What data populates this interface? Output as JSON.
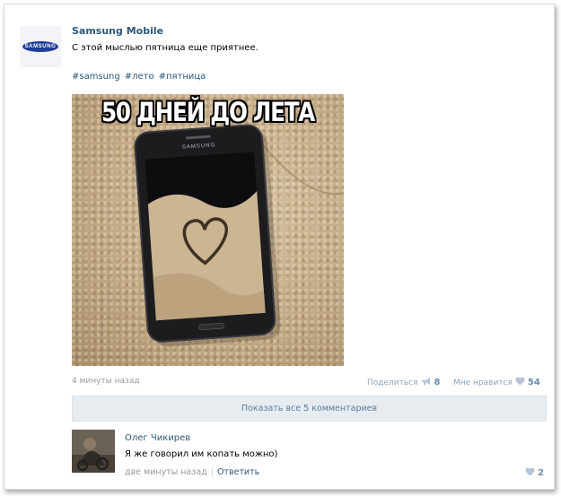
{
  "post": {
    "author": "Samsung Mobile",
    "avatar_logo": "SAMSUNG",
    "text": "С этой мыслью пятница еще приятнее.",
    "hashtags": [
      "#samsung",
      "#лето",
      "#пятница"
    ],
    "image": {
      "caption": "50 ДНЕЙ ДО ЛЕТА",
      "phone_brand": "SAMSUNG"
    },
    "time": "4 минуты назад",
    "share_label": "Поделиться",
    "share_count": "8",
    "like_label": "Мне нравится",
    "like_count": "54",
    "show_comments_label": "Показать все 5 комментариев"
  },
  "comment": {
    "author": "Олег Чикирев",
    "text": "Я же говорил им копать можно)",
    "time": "две минуты назад",
    "reply_label": "Ответить",
    "like_count": "2"
  },
  "icons": {
    "share": "megaphone-icon",
    "like": "heart-icon"
  },
  "colors": {
    "link": "#2b587a",
    "button_bg": "#e7ecf1",
    "muted": "#999999"
  }
}
